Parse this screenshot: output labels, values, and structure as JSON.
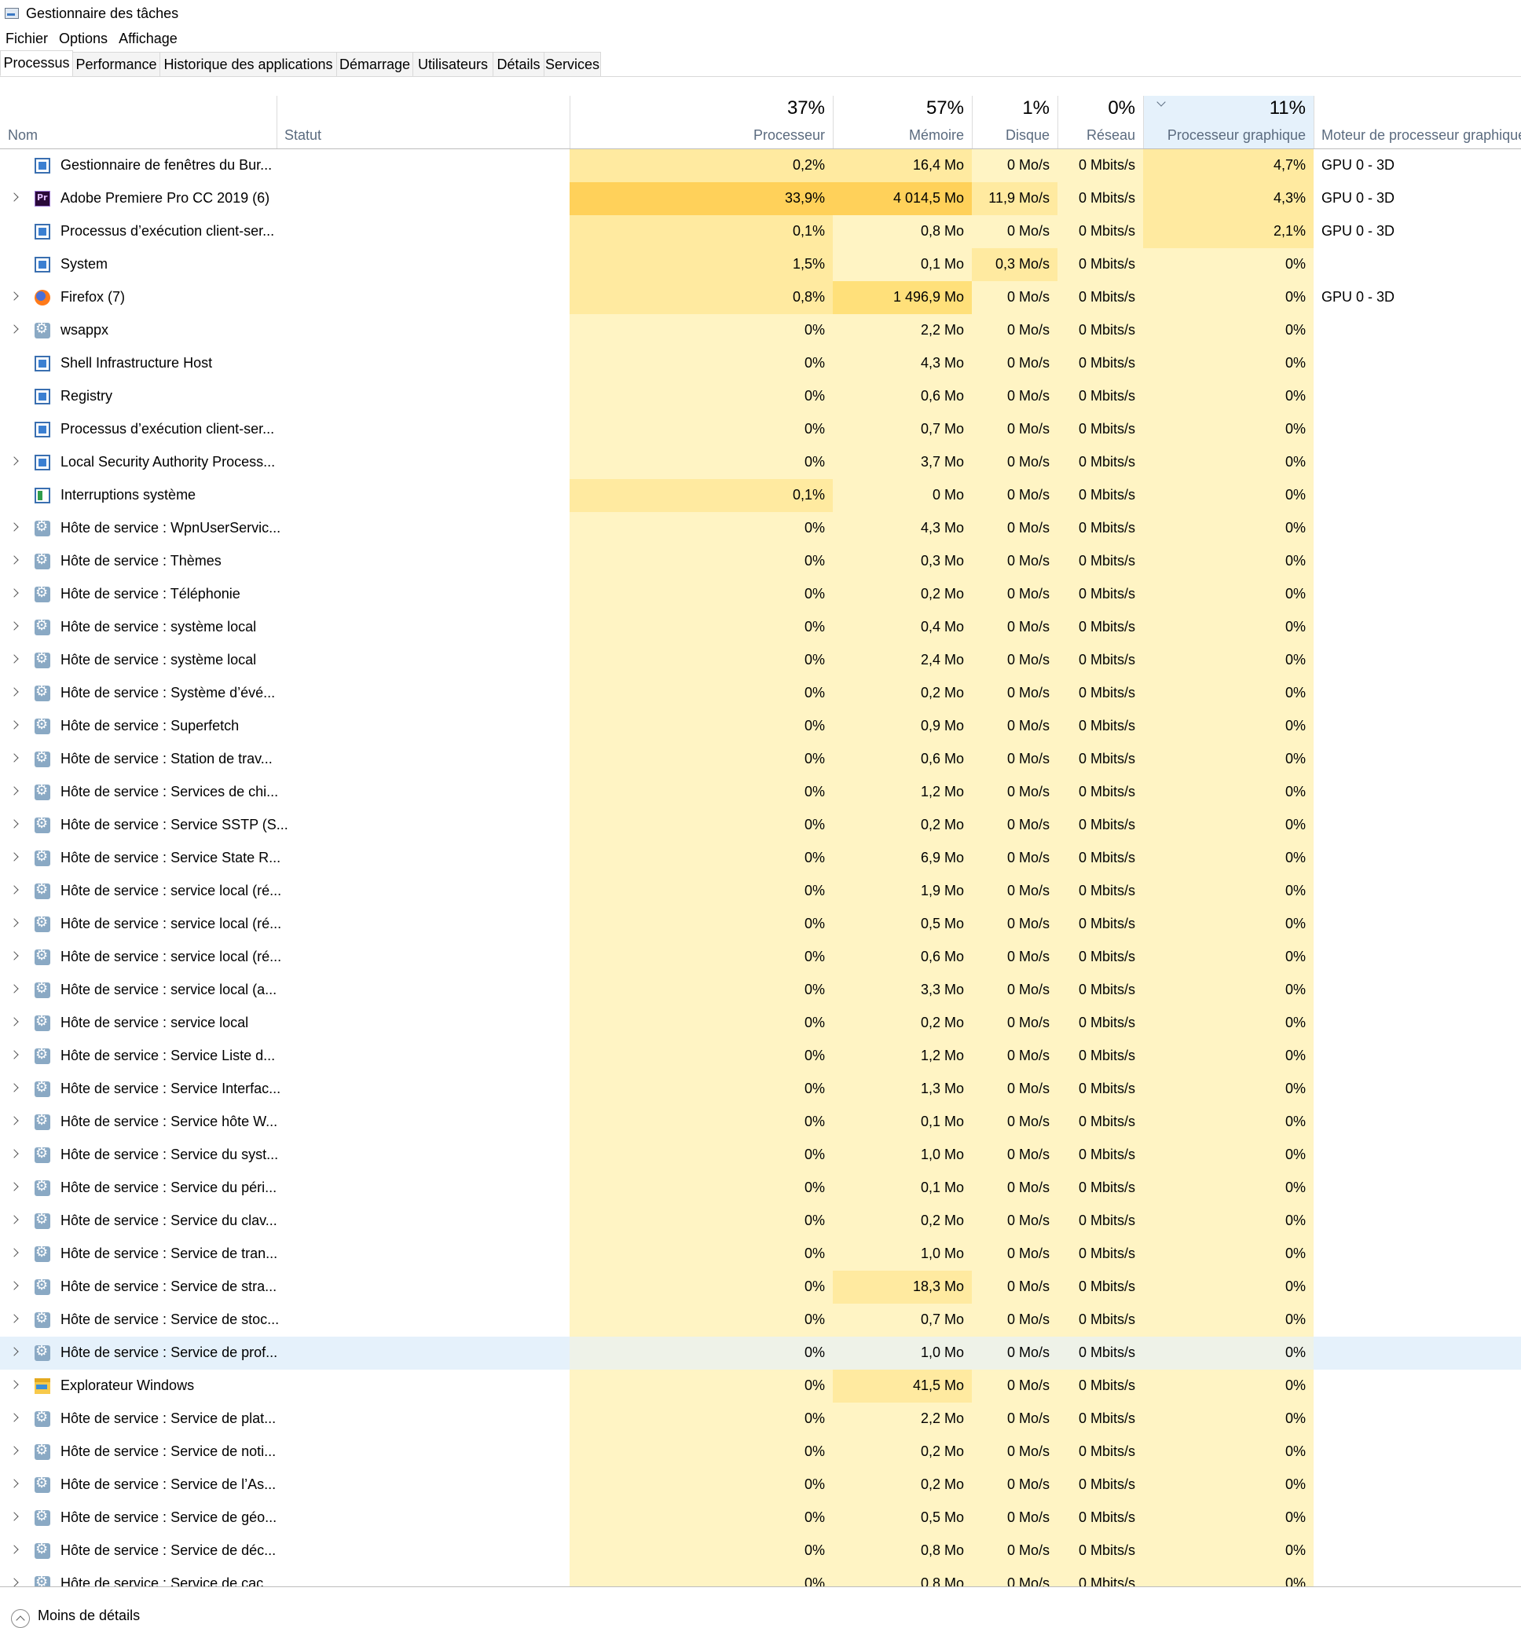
{
  "window": {
    "title": "Gestionnaire des tâches"
  },
  "menu": [
    "Fichier",
    "Options",
    "Affichage"
  ],
  "tabs": [
    "Processus",
    "Performance",
    "Historique des applications",
    "Démarrage",
    "Utilisateurs",
    "Détails",
    "Services"
  ],
  "active_tab": "Processus",
  "columns": {
    "name": "Nom",
    "status": "Statut",
    "cpu": {
      "pct": "37%",
      "label": "Processeur"
    },
    "mem": {
      "pct": "57%",
      "label": "Mémoire"
    },
    "disk": {
      "pct": "1%",
      "label": "Disque"
    },
    "net": {
      "pct": "0%",
      "label": "Réseau"
    },
    "gpu": {
      "pct": "11%",
      "label": "Processeur graphique"
    },
    "gpu_engine": "Moteur de processeur graphique"
  },
  "sorted_column": "gpu",
  "rows": [
    {
      "expand": false,
      "icon": "window",
      "name": "Gestionnaire de fenêtres du Bur...",
      "cpu": "0,2%",
      "mem": "16,4 Mo",
      "disk": "0 Mo/s",
      "net": "0 Mbits/s",
      "gpu": "4,7%",
      "engine": "GPU 0 - 3D",
      "heat": {
        "cpu": 2,
        "mem": 2,
        "disk": 1,
        "net": 1,
        "gpu": 2
      }
    },
    {
      "expand": true,
      "icon": "premiere",
      "name": "Adobe Premiere Pro CC 2019 (6)",
      "cpu": "33,9%",
      "mem": "4 014,5 Mo",
      "disk": "11,9 Mo/s",
      "net": "0 Mbits/s",
      "gpu": "4,3%",
      "engine": "GPU 0 - 3D",
      "heat": {
        "cpu": 4,
        "mem": 4,
        "disk": 2,
        "net": 1,
        "gpu": 2
      }
    },
    {
      "expand": false,
      "icon": "window",
      "name": "Processus d’exécution client-ser...",
      "cpu": "0,1%",
      "mem": "0,8 Mo",
      "disk": "0 Mo/s",
      "net": "0 Mbits/s",
      "gpu": "2,1%",
      "engine": "GPU 0 - 3D",
      "heat": {
        "cpu": 2,
        "mem": 1,
        "disk": 1,
        "net": 1,
        "gpu": 2
      }
    },
    {
      "expand": false,
      "icon": "window",
      "name": "System",
      "cpu": "1,5%",
      "mem": "0,1 Mo",
      "disk": "0,3 Mo/s",
      "net": "0 Mbits/s",
      "gpu": "0%",
      "engine": "",
      "heat": {
        "cpu": 2,
        "mem": 1,
        "disk": 2,
        "net": 1,
        "gpu": 1
      }
    },
    {
      "expand": true,
      "icon": "firefox",
      "name": "Firefox (7)",
      "cpu": "0,8%",
      "mem": "1 496,9 Mo",
      "disk": "0 Mo/s",
      "net": "0 Mbits/s",
      "gpu": "0%",
      "engine": "GPU 0 - 3D",
      "heat": {
        "cpu": 2,
        "mem": 3,
        "disk": 1,
        "net": 1,
        "gpu": 1
      }
    },
    {
      "expand": true,
      "icon": "gear",
      "name": "wsappx",
      "cpu": "0%",
      "mem": "2,2 Mo",
      "disk": "0 Mo/s",
      "net": "0 Mbits/s",
      "gpu": "0%",
      "engine": "",
      "heat": {
        "cpu": 1,
        "mem": 1,
        "disk": 1,
        "net": 1,
        "gpu": 1
      }
    },
    {
      "expand": false,
      "icon": "window",
      "name": "Shell Infrastructure Host",
      "cpu": "0%",
      "mem": "4,3 Mo",
      "disk": "0 Mo/s",
      "net": "0 Mbits/s",
      "gpu": "0%",
      "engine": "",
      "heat": {
        "cpu": 1,
        "mem": 1,
        "disk": 1,
        "net": 1,
        "gpu": 1
      }
    },
    {
      "expand": false,
      "icon": "window",
      "name": "Registry",
      "cpu": "0%",
      "mem": "0,6 Mo",
      "disk": "0 Mo/s",
      "net": "0 Mbits/s",
      "gpu": "0%",
      "engine": "",
      "heat": {
        "cpu": 1,
        "mem": 1,
        "disk": 1,
        "net": 1,
        "gpu": 1
      }
    },
    {
      "expand": false,
      "icon": "window",
      "name": "Processus d’exécution client-ser...",
      "cpu": "0%",
      "mem": "0,7 Mo",
      "disk": "0 Mo/s",
      "net": "0 Mbits/s",
      "gpu": "0%",
      "engine": "",
      "heat": {
        "cpu": 1,
        "mem": 1,
        "disk": 1,
        "net": 1,
        "gpu": 1
      }
    },
    {
      "expand": true,
      "icon": "window",
      "name": "Local Security Authority Process...",
      "cpu": "0%",
      "mem": "3,7 Mo",
      "disk": "0 Mo/s",
      "net": "0 Mbits/s",
      "gpu": "0%",
      "engine": "",
      "heat": {
        "cpu": 1,
        "mem": 1,
        "disk": 1,
        "net": 1,
        "gpu": 1
      }
    },
    {
      "expand": false,
      "icon": "irq",
      "name": "Interruptions système",
      "cpu": "0,1%",
      "mem": "0 Mo",
      "disk": "0 Mo/s",
      "net": "0 Mbits/s",
      "gpu": "0%",
      "engine": "",
      "heat": {
        "cpu": 2,
        "mem": 0,
        "disk": 1,
        "net": 1,
        "gpu": 1
      }
    },
    {
      "expand": true,
      "icon": "gear",
      "name": "Hôte de service : WpnUserServic...",
      "cpu": "0%",
      "mem": "4,3 Mo",
      "disk": "0 Mo/s",
      "net": "0 Mbits/s",
      "gpu": "0%",
      "engine": "",
      "heat": {
        "cpu": 1,
        "mem": 1,
        "disk": 1,
        "net": 1,
        "gpu": 1
      }
    },
    {
      "expand": true,
      "icon": "gear",
      "name": "Hôte de service : Thèmes",
      "cpu": "0%",
      "mem": "0,3 Mo",
      "disk": "0 Mo/s",
      "net": "0 Mbits/s",
      "gpu": "0%",
      "engine": "",
      "heat": {
        "cpu": 1,
        "mem": 1,
        "disk": 1,
        "net": 1,
        "gpu": 1
      }
    },
    {
      "expand": true,
      "icon": "gear",
      "name": "Hôte de service : Téléphonie",
      "cpu": "0%",
      "mem": "0,2 Mo",
      "disk": "0 Mo/s",
      "net": "0 Mbits/s",
      "gpu": "0%",
      "engine": "",
      "heat": {
        "cpu": 1,
        "mem": 1,
        "disk": 1,
        "net": 1,
        "gpu": 1
      }
    },
    {
      "expand": true,
      "icon": "gear",
      "name": "Hôte de service : système local",
      "cpu": "0%",
      "mem": "0,4 Mo",
      "disk": "0 Mo/s",
      "net": "0 Mbits/s",
      "gpu": "0%",
      "engine": "",
      "heat": {
        "cpu": 1,
        "mem": 1,
        "disk": 1,
        "net": 1,
        "gpu": 1
      }
    },
    {
      "expand": true,
      "icon": "gear",
      "name": "Hôte de service : système local",
      "cpu": "0%",
      "mem": "2,4 Mo",
      "disk": "0 Mo/s",
      "net": "0 Mbits/s",
      "gpu": "0%",
      "engine": "",
      "heat": {
        "cpu": 1,
        "mem": 1,
        "disk": 1,
        "net": 1,
        "gpu": 1
      }
    },
    {
      "expand": true,
      "icon": "gear",
      "name": "Hôte de service : Système d’évé...",
      "cpu": "0%",
      "mem": "0,2 Mo",
      "disk": "0 Mo/s",
      "net": "0 Mbits/s",
      "gpu": "0%",
      "engine": "",
      "heat": {
        "cpu": 1,
        "mem": 1,
        "disk": 1,
        "net": 1,
        "gpu": 1
      }
    },
    {
      "expand": true,
      "icon": "gear",
      "name": "Hôte de service : Superfetch",
      "cpu": "0%",
      "mem": "0,9 Mo",
      "disk": "0 Mo/s",
      "net": "0 Mbits/s",
      "gpu": "0%",
      "engine": "",
      "heat": {
        "cpu": 1,
        "mem": 1,
        "disk": 1,
        "net": 1,
        "gpu": 1
      }
    },
    {
      "expand": true,
      "icon": "gear",
      "name": "Hôte de service : Station de trav...",
      "cpu": "0%",
      "mem": "0,6 Mo",
      "disk": "0 Mo/s",
      "net": "0 Mbits/s",
      "gpu": "0%",
      "engine": "",
      "heat": {
        "cpu": 1,
        "mem": 1,
        "disk": 1,
        "net": 1,
        "gpu": 1
      }
    },
    {
      "expand": true,
      "icon": "gear",
      "name": "Hôte de service : Services de chi...",
      "cpu": "0%",
      "mem": "1,2 Mo",
      "disk": "0 Mo/s",
      "net": "0 Mbits/s",
      "gpu": "0%",
      "engine": "",
      "heat": {
        "cpu": 1,
        "mem": 1,
        "disk": 1,
        "net": 1,
        "gpu": 1
      }
    },
    {
      "expand": true,
      "icon": "gear",
      "name": "Hôte de service : Service SSTP (S...",
      "cpu": "0%",
      "mem": "0,2 Mo",
      "disk": "0 Mo/s",
      "net": "0 Mbits/s",
      "gpu": "0%",
      "engine": "",
      "heat": {
        "cpu": 1,
        "mem": 1,
        "disk": 1,
        "net": 1,
        "gpu": 1
      }
    },
    {
      "expand": true,
      "icon": "gear",
      "name": "Hôte de service : Service State R...",
      "cpu": "0%",
      "mem": "6,9 Mo",
      "disk": "0 Mo/s",
      "net": "0 Mbits/s",
      "gpu": "0%",
      "engine": "",
      "heat": {
        "cpu": 1,
        "mem": 1,
        "disk": 1,
        "net": 1,
        "gpu": 1
      }
    },
    {
      "expand": true,
      "icon": "gear",
      "name": "Hôte de service : service local (ré...",
      "cpu": "0%",
      "mem": "1,9 Mo",
      "disk": "0 Mo/s",
      "net": "0 Mbits/s",
      "gpu": "0%",
      "engine": "",
      "heat": {
        "cpu": 1,
        "mem": 1,
        "disk": 1,
        "net": 1,
        "gpu": 1
      }
    },
    {
      "expand": true,
      "icon": "gear",
      "name": "Hôte de service : service local (ré...",
      "cpu": "0%",
      "mem": "0,5 Mo",
      "disk": "0 Mo/s",
      "net": "0 Mbits/s",
      "gpu": "0%",
      "engine": "",
      "heat": {
        "cpu": 1,
        "mem": 1,
        "disk": 1,
        "net": 1,
        "gpu": 1
      }
    },
    {
      "expand": true,
      "icon": "gear",
      "name": "Hôte de service : service local (ré...",
      "cpu": "0%",
      "mem": "0,6 Mo",
      "disk": "0 Mo/s",
      "net": "0 Mbits/s",
      "gpu": "0%",
      "engine": "",
      "heat": {
        "cpu": 1,
        "mem": 1,
        "disk": 1,
        "net": 1,
        "gpu": 1
      }
    },
    {
      "expand": true,
      "icon": "gear",
      "name": "Hôte de service : service local (a...",
      "cpu": "0%",
      "mem": "3,3 Mo",
      "disk": "0 Mo/s",
      "net": "0 Mbits/s",
      "gpu": "0%",
      "engine": "",
      "heat": {
        "cpu": 1,
        "mem": 1,
        "disk": 1,
        "net": 1,
        "gpu": 1
      }
    },
    {
      "expand": true,
      "icon": "gear",
      "name": "Hôte de service : service local",
      "cpu": "0%",
      "mem": "0,2 Mo",
      "disk": "0 Mo/s",
      "net": "0 Mbits/s",
      "gpu": "0%",
      "engine": "",
      "heat": {
        "cpu": 1,
        "mem": 1,
        "disk": 1,
        "net": 1,
        "gpu": 1
      }
    },
    {
      "expand": true,
      "icon": "gear",
      "name": "Hôte de service : Service Liste d...",
      "cpu": "0%",
      "mem": "1,2 Mo",
      "disk": "0 Mo/s",
      "net": "0 Mbits/s",
      "gpu": "0%",
      "engine": "",
      "heat": {
        "cpu": 1,
        "mem": 1,
        "disk": 1,
        "net": 1,
        "gpu": 1
      }
    },
    {
      "expand": true,
      "icon": "gear",
      "name": "Hôte de service : Service Interfac...",
      "cpu": "0%",
      "mem": "1,3 Mo",
      "disk": "0 Mo/s",
      "net": "0 Mbits/s",
      "gpu": "0%",
      "engine": "",
      "heat": {
        "cpu": 1,
        "mem": 1,
        "disk": 1,
        "net": 1,
        "gpu": 1
      }
    },
    {
      "expand": true,
      "icon": "gear",
      "name": "Hôte de service : Service hôte W...",
      "cpu": "0%",
      "mem": "0,1 Mo",
      "disk": "0 Mo/s",
      "net": "0 Mbits/s",
      "gpu": "0%",
      "engine": "",
      "heat": {
        "cpu": 1,
        "mem": 1,
        "disk": 1,
        "net": 1,
        "gpu": 1
      }
    },
    {
      "expand": true,
      "icon": "gear",
      "name": "Hôte de service : Service du syst...",
      "cpu": "0%",
      "mem": "1,0 Mo",
      "disk": "0 Mo/s",
      "net": "0 Mbits/s",
      "gpu": "0%",
      "engine": "",
      "heat": {
        "cpu": 1,
        "mem": 1,
        "disk": 1,
        "net": 1,
        "gpu": 1
      }
    },
    {
      "expand": true,
      "icon": "gear",
      "name": "Hôte de service : Service du péri...",
      "cpu": "0%",
      "mem": "0,1 Mo",
      "disk": "0 Mo/s",
      "net": "0 Mbits/s",
      "gpu": "0%",
      "engine": "",
      "heat": {
        "cpu": 1,
        "mem": 1,
        "disk": 1,
        "net": 1,
        "gpu": 1
      }
    },
    {
      "expand": true,
      "icon": "gear",
      "name": "Hôte de service : Service du clav...",
      "cpu": "0%",
      "mem": "0,2 Mo",
      "disk": "0 Mo/s",
      "net": "0 Mbits/s",
      "gpu": "0%",
      "engine": "",
      "heat": {
        "cpu": 1,
        "mem": 1,
        "disk": 1,
        "net": 1,
        "gpu": 1
      }
    },
    {
      "expand": true,
      "icon": "gear",
      "name": "Hôte de service : Service de tran...",
      "cpu": "0%",
      "mem": "1,0 Mo",
      "disk": "0 Mo/s",
      "net": "0 Mbits/s",
      "gpu": "0%",
      "engine": "",
      "heat": {
        "cpu": 1,
        "mem": 1,
        "disk": 1,
        "net": 1,
        "gpu": 1
      }
    },
    {
      "expand": true,
      "icon": "gear",
      "name": "Hôte de service : Service de stra...",
      "cpu": "0%",
      "mem": "18,3 Mo",
      "disk": "0 Mo/s",
      "net": "0 Mbits/s",
      "gpu": "0%",
      "engine": "",
      "heat": {
        "cpu": 1,
        "mem": 2,
        "disk": 1,
        "net": 1,
        "gpu": 1
      }
    },
    {
      "expand": true,
      "icon": "gear",
      "name": "Hôte de service : Service de stoc...",
      "cpu": "0%",
      "mem": "0,7 Mo",
      "disk": "0 Mo/s",
      "net": "0 Mbits/s",
      "gpu": "0%",
      "engine": "",
      "heat": {
        "cpu": 1,
        "mem": 1,
        "disk": 1,
        "net": 1,
        "gpu": 1
      }
    },
    {
      "expand": true,
      "icon": "gear",
      "name": "Hôte de service : Service de prof...",
      "cpu": "0%",
      "mem": "1,0 Mo",
      "disk": "0 Mo/s",
      "net": "0 Mbits/s",
      "gpu": "0%",
      "engine": "",
      "selected": true,
      "heat": {
        "cpu": 1,
        "mem": 1,
        "disk": 1,
        "net": 1,
        "gpu": 1
      }
    },
    {
      "expand": true,
      "icon": "folder",
      "name": "Explorateur Windows",
      "cpu": "0%",
      "mem": "41,5 Mo",
      "disk": "0 Mo/s",
      "net": "0 Mbits/s",
      "gpu": "0%",
      "engine": "",
      "heat": {
        "cpu": 1,
        "mem": 2,
        "disk": 1,
        "net": 1,
        "gpu": 1
      }
    },
    {
      "expand": true,
      "icon": "gear",
      "name": "Hôte de service : Service de plat...",
      "cpu": "0%",
      "mem": "2,2 Mo",
      "disk": "0 Mo/s",
      "net": "0 Mbits/s",
      "gpu": "0%",
      "engine": "",
      "heat": {
        "cpu": 1,
        "mem": 1,
        "disk": 1,
        "net": 1,
        "gpu": 1
      }
    },
    {
      "expand": true,
      "icon": "gear",
      "name": "Hôte de service : Service de noti...",
      "cpu": "0%",
      "mem": "0,2 Mo",
      "disk": "0 Mo/s",
      "net": "0 Mbits/s",
      "gpu": "0%",
      "engine": "",
      "heat": {
        "cpu": 1,
        "mem": 1,
        "disk": 1,
        "net": 1,
        "gpu": 1
      }
    },
    {
      "expand": true,
      "icon": "gear",
      "name": "Hôte de service : Service de l’As...",
      "cpu": "0%",
      "mem": "0,2 Mo",
      "disk": "0 Mo/s",
      "net": "0 Mbits/s",
      "gpu": "0%",
      "engine": "",
      "heat": {
        "cpu": 1,
        "mem": 1,
        "disk": 1,
        "net": 1,
        "gpu": 1
      }
    },
    {
      "expand": true,
      "icon": "gear",
      "name": "Hôte de service : Service de géo...",
      "cpu": "0%",
      "mem": "0,5 Mo",
      "disk": "0 Mo/s",
      "net": "0 Mbits/s",
      "gpu": "0%",
      "engine": "",
      "heat": {
        "cpu": 1,
        "mem": 1,
        "disk": 1,
        "net": 1,
        "gpu": 1
      }
    },
    {
      "expand": true,
      "icon": "gear",
      "name": "Hôte de service : Service de déc...",
      "cpu": "0%",
      "mem": "0,8 Mo",
      "disk": "0 Mo/s",
      "net": "0 Mbits/s",
      "gpu": "0%",
      "engine": "",
      "heat": {
        "cpu": 1,
        "mem": 1,
        "disk": 1,
        "net": 1,
        "gpu": 1
      }
    },
    {
      "expand": true,
      "icon": "gear",
      "name": "Hôte de service : Service de cac...",
      "cpu": "0%",
      "mem": "0,8 Mo",
      "disk": "0 Mo/s",
      "net": "0 Mbits/s",
      "gpu": "0%",
      "engine": "",
      "heat": {
        "cpu": 1,
        "mem": 1,
        "disk": 1,
        "net": 1,
        "gpu": 1
      }
    }
  ],
  "heat_colors": [
    "#fff4c4",
    "#fff4c4",
    "#ffeaa0",
    "#ffe07a",
    "#ffd15a"
  ],
  "bottom": {
    "fewer_details": "Moins de détails"
  }
}
